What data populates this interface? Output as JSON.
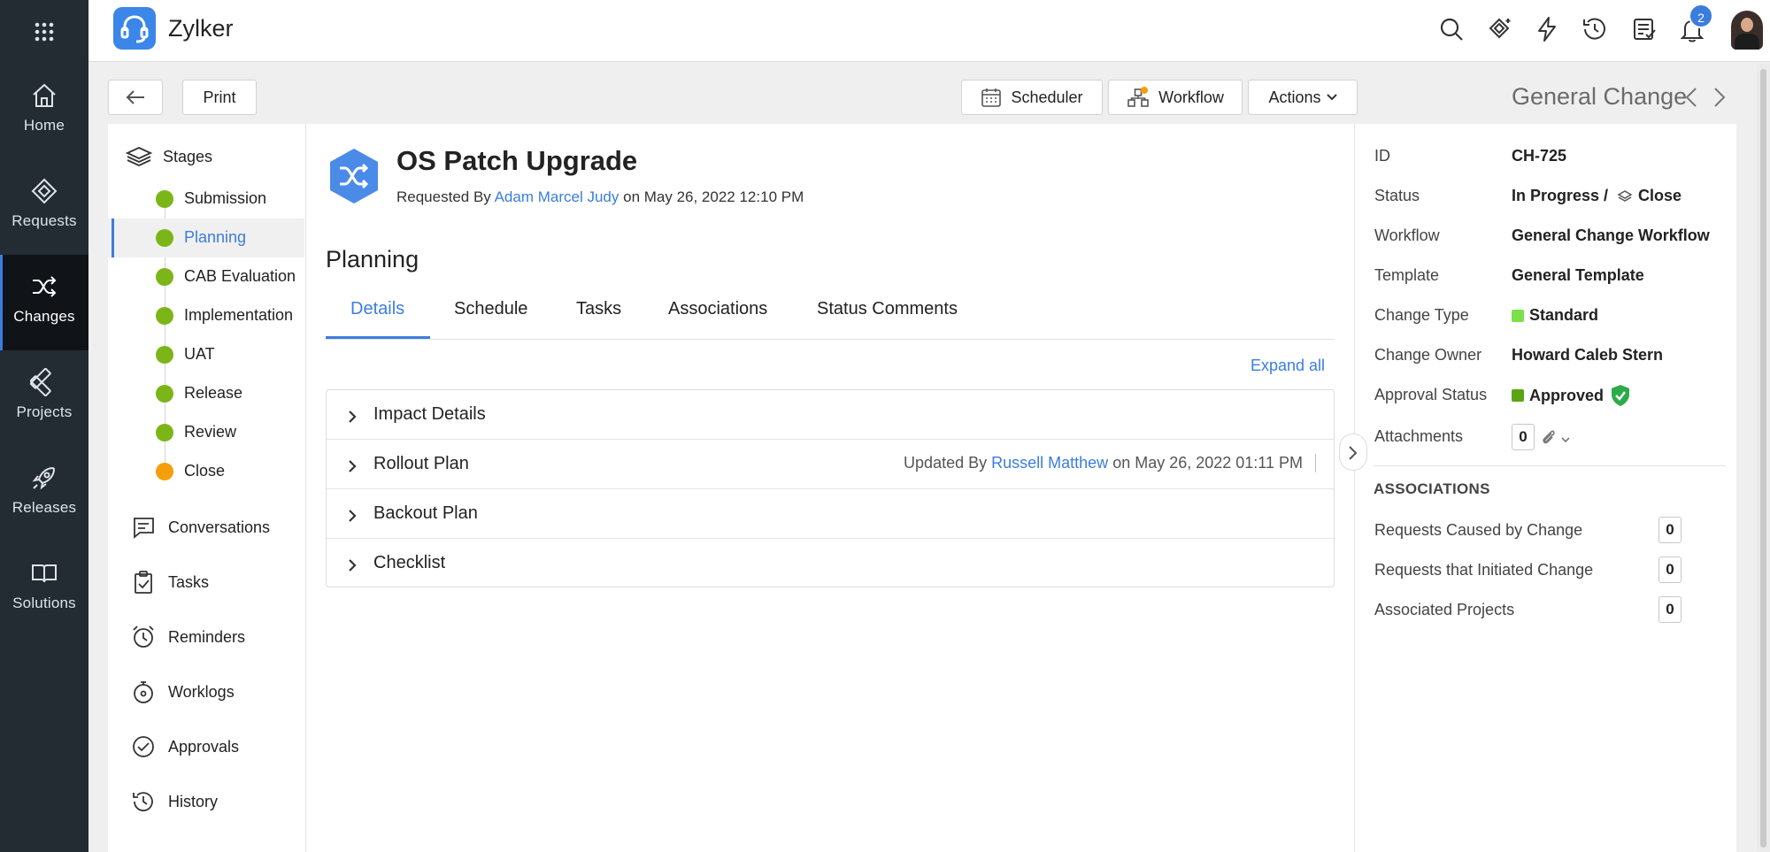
{
  "app": {
    "name": "Zylker",
    "notification_count": "2"
  },
  "leftnav": [
    {
      "id": "home",
      "label": "Home"
    },
    {
      "id": "requests",
      "label": "Requests"
    },
    {
      "id": "changes",
      "label": "Changes",
      "active": true
    },
    {
      "id": "projects",
      "label": "Projects"
    },
    {
      "id": "releases",
      "label": "Releases"
    },
    {
      "id": "solutions",
      "label": "Solutions"
    }
  ],
  "toolbar": {
    "print_label": "Print",
    "scheduler_label": "Scheduler",
    "workflow_label": "Workflow",
    "actions_label": "Actions",
    "template_title": "General Change"
  },
  "stages": {
    "header": "Stages",
    "items": [
      {
        "label": "Submission",
        "state": "done"
      },
      {
        "label": "Planning",
        "state": "done",
        "active": true
      },
      {
        "label": "CAB Evaluation",
        "state": "done"
      },
      {
        "label": "Implementation",
        "state": "done"
      },
      {
        "label": "UAT",
        "state": "done"
      },
      {
        "label": "Release",
        "state": "done"
      },
      {
        "label": "Review",
        "state": "done"
      },
      {
        "label": "Close",
        "state": "pending"
      }
    ]
  },
  "sidelinks": [
    "Conversations",
    "Tasks",
    "Reminders",
    "Worklogs",
    "Approvals",
    "History"
  ],
  "request": {
    "title": "OS Patch Upgrade",
    "requested_by_prefix": "Requested By",
    "requester": "Adam Marcel Judy",
    "date": "on May 26, 2022 12:10 PM"
  },
  "section": {
    "title": "Planning",
    "tabs": [
      "Details",
      "Schedule",
      "Tasks",
      "Associations",
      "Status Comments"
    ],
    "expand_all": "Expand all",
    "accordion": [
      {
        "label": "Impact Details"
      },
      {
        "label": "Rollout Plan",
        "updated_prefix": "Updated By",
        "updated_by": "Russell Matthew",
        "updated_date": "on May 26, 2022 01:11 PM"
      },
      {
        "label": "Backout Plan"
      },
      {
        "label": "Checklist"
      }
    ]
  },
  "properties": {
    "id_label": "ID",
    "id": "CH-725",
    "status_label": "Status",
    "status": "In Progress /",
    "status_next": "Close",
    "workflow_label": "Workflow",
    "workflow": "General Change Workflow",
    "template_label": "Template",
    "template": "General Template",
    "change_type_label": "Change Type",
    "change_type": "Standard",
    "change_type_color": "#7be04a",
    "owner_label": "Change Owner",
    "owner": "Howard Caleb Stern",
    "approval_label": "Approval Status",
    "approval": "Approved",
    "approval_color": "#5aa415",
    "attachments_label": "Attachments",
    "attachments": "0"
  },
  "associations": {
    "header": "ASSOCIATIONS",
    "items": [
      {
        "label": "Requests Caused by Change",
        "count": "0"
      },
      {
        "label": "Requests that Initiated Change",
        "count": "0"
      },
      {
        "label": "Associated Projects",
        "count": "0"
      }
    ]
  },
  "colors": {
    "accent": "#3b7ddd",
    "nav_bg": "#232b33",
    "stage_done": "#7cb518",
    "stage_pending": "#f59e0b"
  }
}
